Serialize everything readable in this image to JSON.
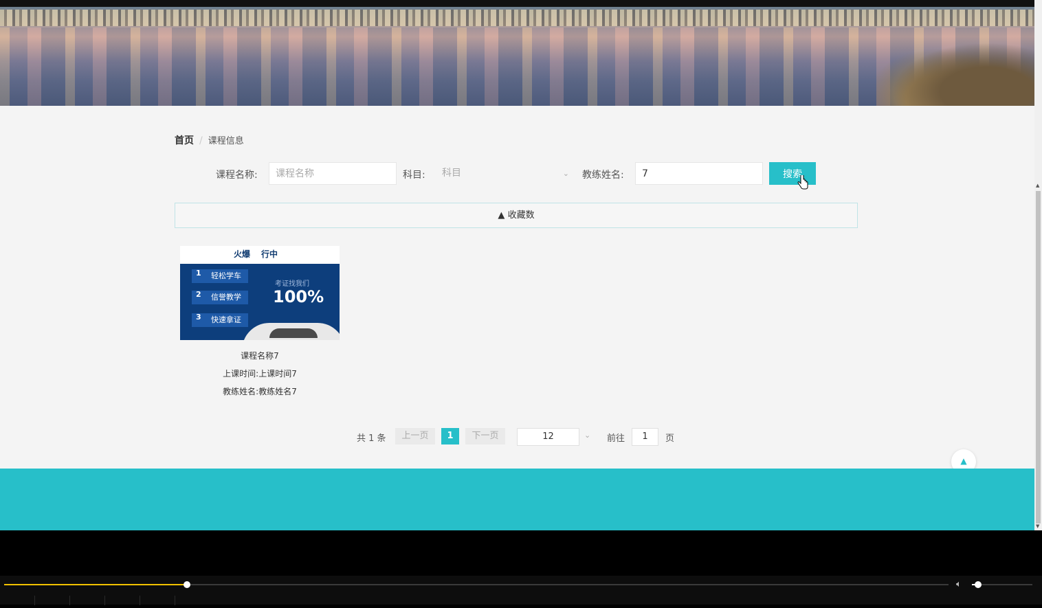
{
  "breadcrumb": {
    "home": "首页",
    "separator": "/",
    "current": "课程信息"
  },
  "search": {
    "course_name_label": "课程名称:",
    "course_name_placeholder": "课程名称",
    "subject_label": "科目:",
    "subject_placeholder": "科目",
    "coach_name_label": "教练姓名:",
    "coach_name_value": "7",
    "search_button": "搜索"
  },
  "sort": {
    "label": "收藏数",
    "icon": "sort-icon"
  },
  "courses": [
    {
      "name": "课程名称7",
      "time_label": "上课时间:",
      "time": "上课时间7",
      "coach_label": "教练姓名:",
      "coach": "教练姓名7",
      "image_text": {
        "top_left": "火爆",
        "top_right": "行中",
        "items": [
          "轻松学车",
          "信誉教学",
          "快速拿证"
        ],
        "numbers": [
          "1",
          "2",
          "3"
        ],
        "badge_small": "考证找我们",
        "badge_big": "100%"
      }
    }
  ],
  "pagination": {
    "total": "共 1 条",
    "prev": "上一页",
    "current": "1",
    "next": "下一页",
    "page_size": "12",
    "goto_label": "前往",
    "goto_value": "1",
    "page_unit": "页"
  },
  "colors": {
    "accent": "#27bfc9"
  },
  "player": {
    "progress": 0.19,
    "volume": 0.1
  }
}
